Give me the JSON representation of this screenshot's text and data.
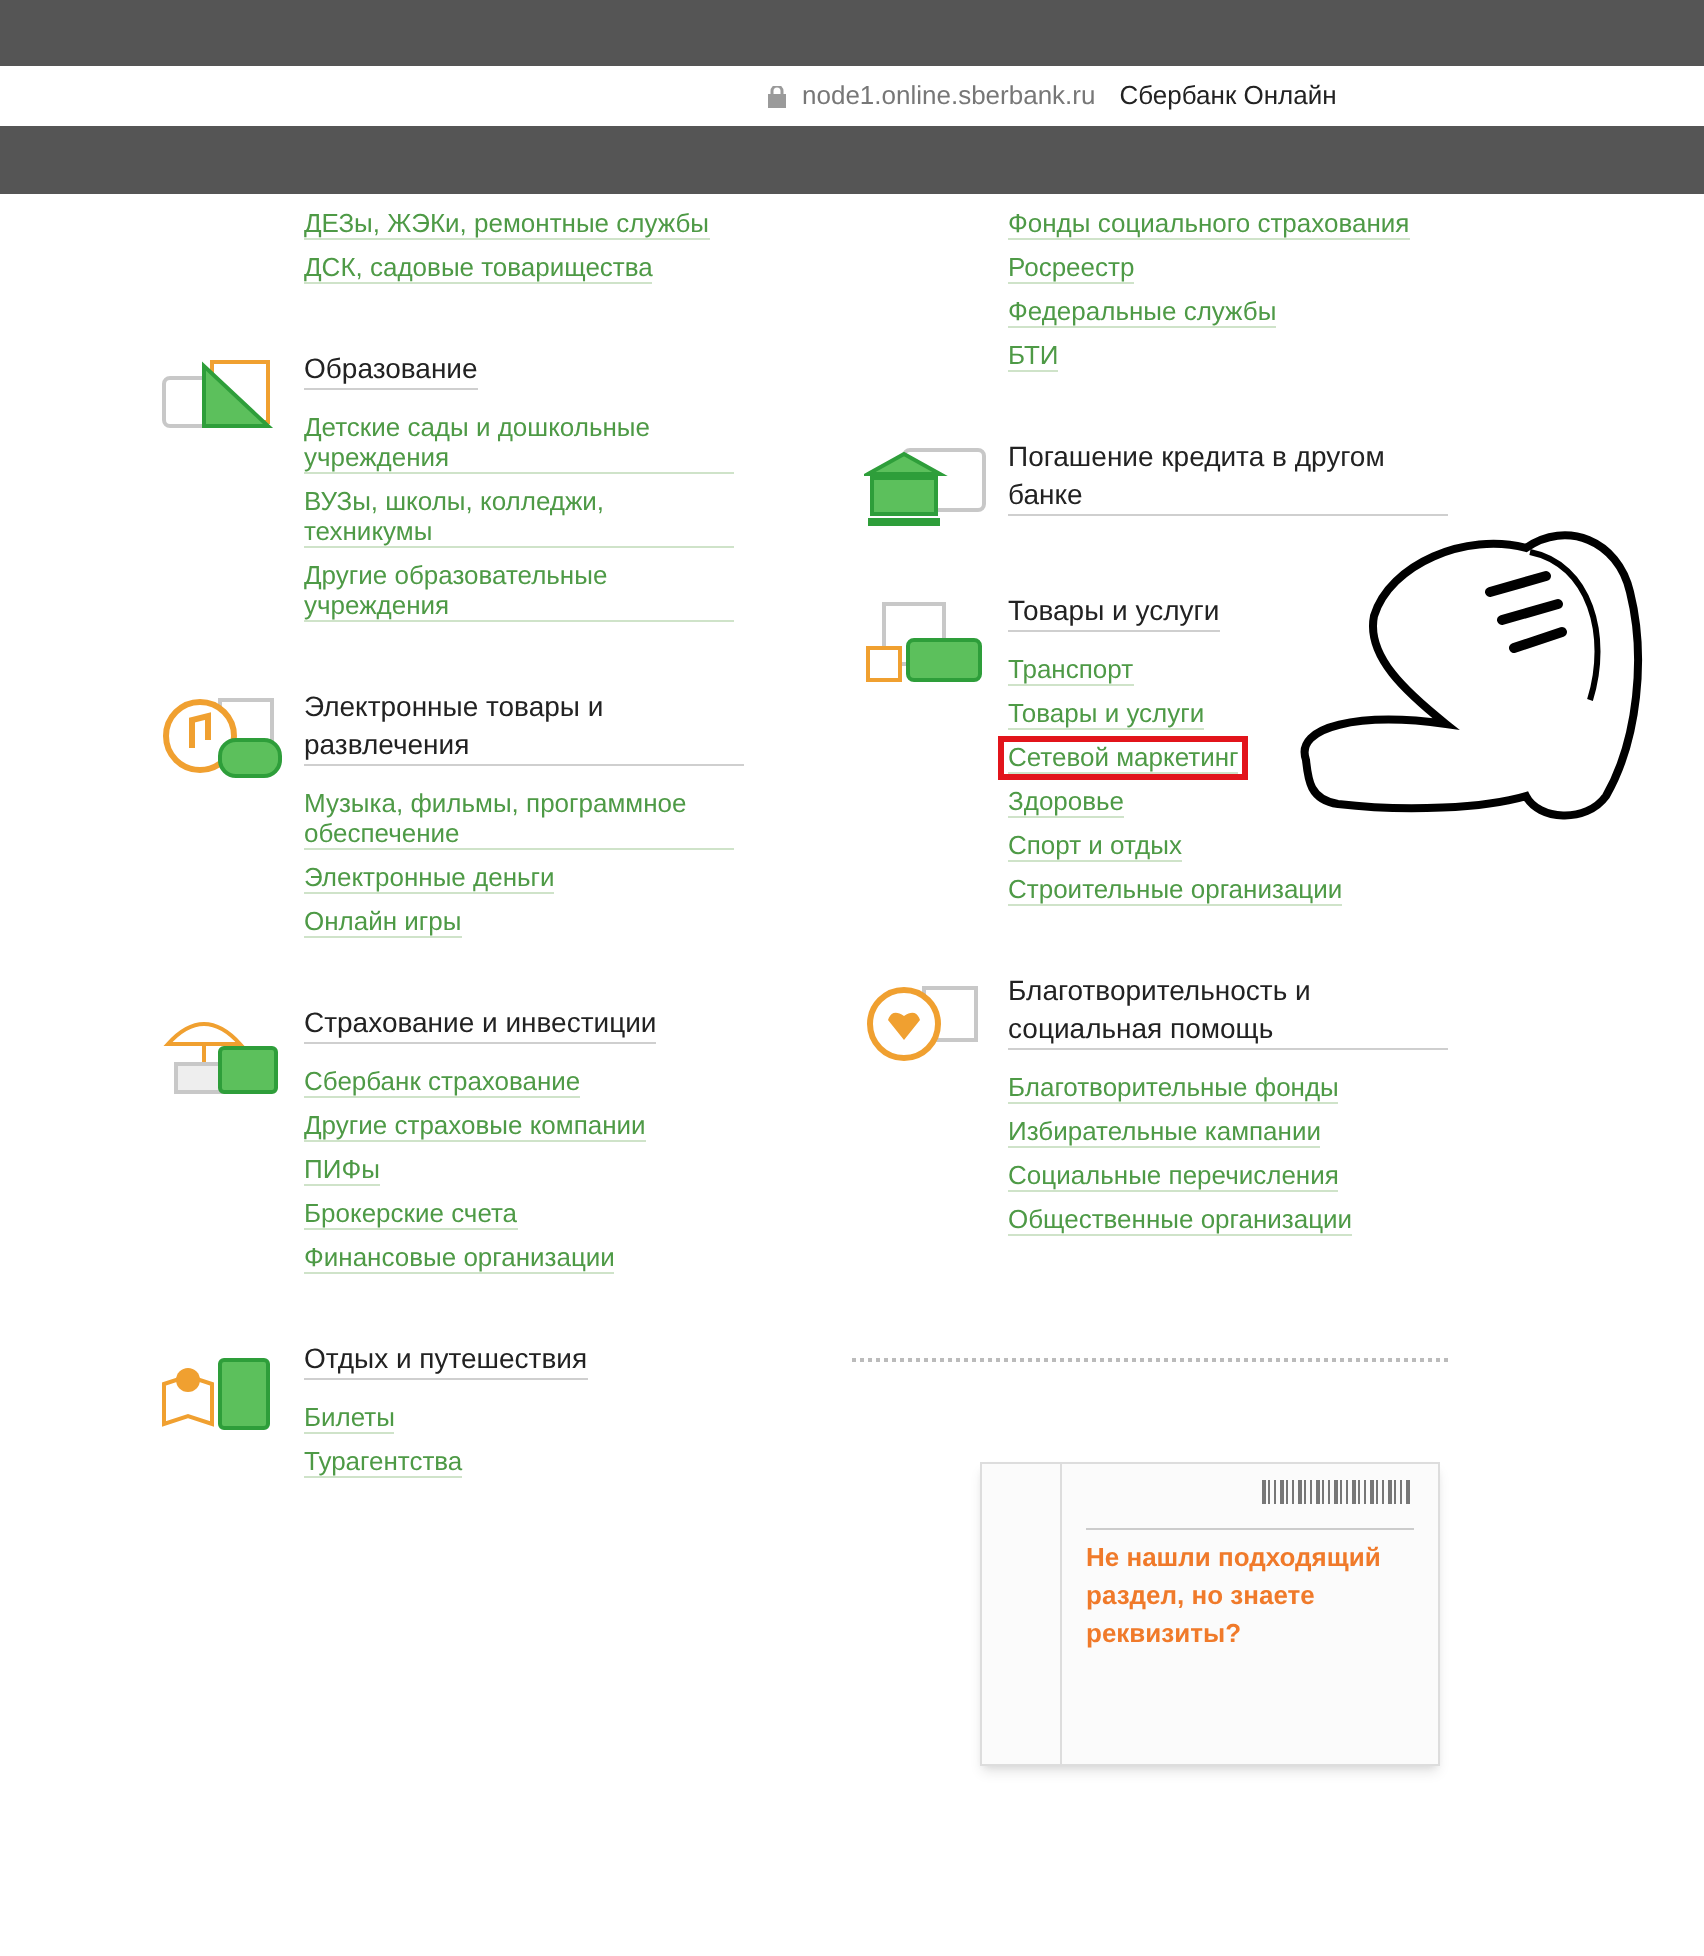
{
  "address_bar": {
    "url": "node1.online.sberbank.ru",
    "site_name": "Сбербанк Онлайн"
  },
  "left_column": [
    {
      "links": [
        {
          "label": "ДЕЗы, ЖЭКи, ремонтные службы",
          "highlighted": false
        },
        {
          "label": "ДСК, садовые товарищества",
          "highlighted": false
        }
      ]
    },
    {
      "title": "Образование",
      "links": [
        {
          "label": "Детские сады и дошкольные учреждения",
          "highlighted": false
        },
        {
          "label": "ВУЗы, школы, колледжи, техникумы",
          "highlighted": false
        },
        {
          "label": "Другие образовательные учреждения",
          "highlighted": false
        }
      ]
    },
    {
      "title": "Электронные товары и развлечения",
      "links": [
        {
          "label": "Музыка, фильмы, программное обеспечение",
          "highlighted": false
        },
        {
          "label": "Электронные деньги",
          "highlighted": false
        },
        {
          "label": "Онлайн игры",
          "highlighted": false
        }
      ]
    },
    {
      "title": "Страхование и инвестиции",
      "links": [
        {
          "label": "Сбербанк страхование",
          "highlighted": false
        },
        {
          "label": "Другие страховые компании",
          "highlighted": false
        },
        {
          "label": "ПИФы",
          "highlighted": false
        },
        {
          "label": "Брокерские счета",
          "highlighted": false
        },
        {
          "label": "Финансовые организации",
          "highlighted": false
        }
      ]
    },
    {
      "title": "Отдых и путешествия",
      "links": [
        {
          "label": "Билеты",
          "highlighted": false
        },
        {
          "label": "Турагентства",
          "highlighted": false
        }
      ]
    }
  ],
  "right_column": [
    {
      "links": [
        {
          "label": "Фонды социального страхования",
          "highlighted": false
        },
        {
          "label": "Росреестр",
          "highlighted": false
        },
        {
          "label": "Федеральные службы",
          "highlighted": false
        },
        {
          "label": "БТИ",
          "highlighted": false
        }
      ]
    },
    {
      "title": "Погашение кредита в другом банке"
    },
    {
      "title": "Товары и услуги",
      "links": [
        {
          "label": "Транспорт",
          "highlighted": false
        },
        {
          "label": "Товары и услуги",
          "highlighted": false
        },
        {
          "label": "Сетевой маркетинг",
          "highlighted": true
        },
        {
          "label": "Здоровье",
          "highlighted": false
        },
        {
          "label": "Спорт и отдых",
          "highlighted": false
        },
        {
          "label": "Строительные организации",
          "highlighted": false
        }
      ]
    },
    {
      "title": "Благотворительность и социальная помощь",
      "links": [
        {
          "label": "Благотворительные фонды",
          "highlighted": false
        },
        {
          "label": "Избирательные кампании",
          "highlighted": false
        },
        {
          "label": "Социальные перечисления",
          "highlighted": false
        },
        {
          "label": "Общественные организации",
          "highlighted": false
        }
      ]
    }
  ],
  "requisites_card": {
    "link": "Не нашли подходящий раздел, но знаете реквизиты?"
  }
}
